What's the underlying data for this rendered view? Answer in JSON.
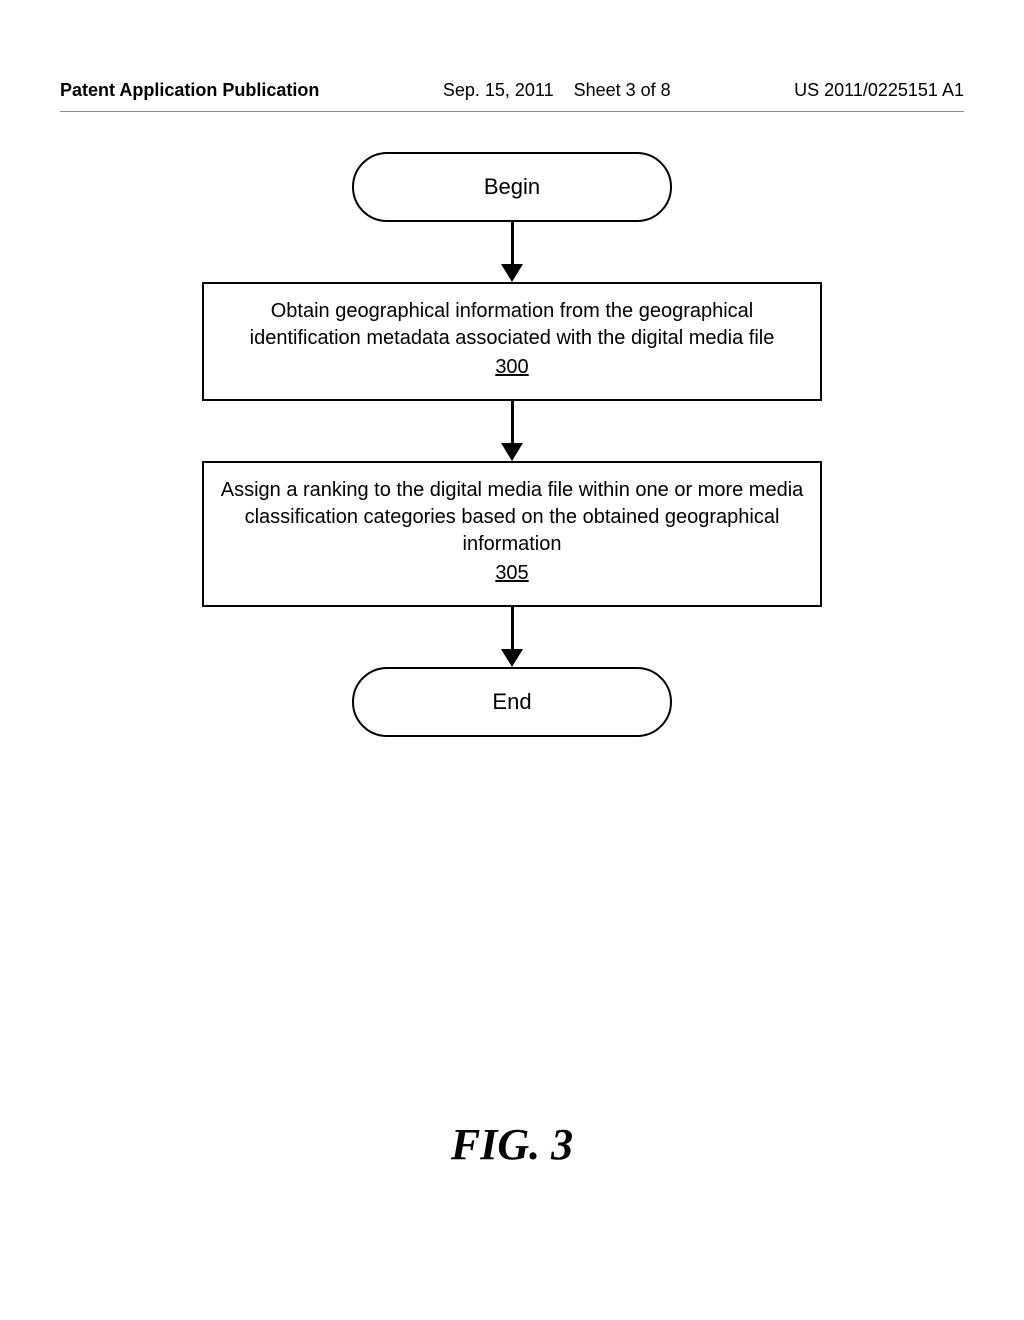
{
  "header": {
    "left": "Patent Application Publication",
    "mid_date": "Sep. 15, 2011",
    "mid_sheet": "Sheet 3 of 8",
    "right": "US 2011/0225151 A1"
  },
  "flow": {
    "begin": "Begin",
    "step1_text": "Obtain geographical information from the geographical identification metadata associated with the digital media file",
    "step1_ref": "300",
    "step2_text": "Assign a ranking to the digital media file within one or more media classification categories based on the obtained geographical information",
    "step2_ref": "305",
    "end": "End"
  },
  "figure_label": "FIG. 3"
}
